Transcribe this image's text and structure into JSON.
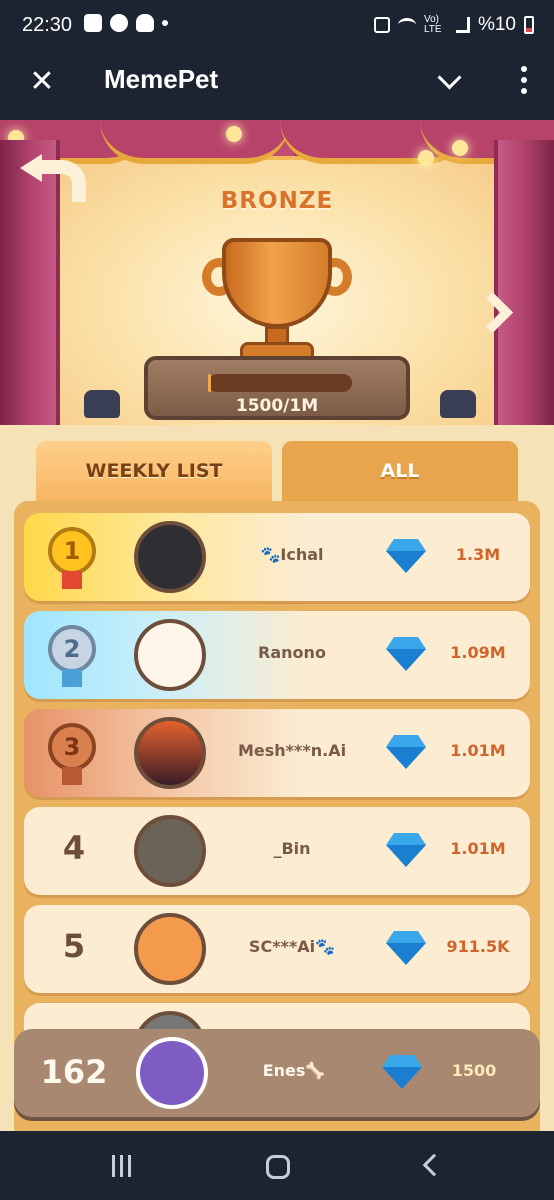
{
  "status_bar": {
    "time": "22:30",
    "battery": "%10",
    "network": "Vo) LTE"
  },
  "app_bar": {
    "title": "MemePet"
  },
  "league": {
    "name": "BRONZE",
    "progress_text": "1500/1M",
    "progress_fraction": 0.0015
  },
  "tabs": [
    {
      "label": "WEEKLY LIST",
      "active": true
    },
    {
      "label": "ALL",
      "active": false
    }
  ],
  "leaderboard": [
    {
      "rank": "1",
      "name": "🐾Ichal",
      "score": "1.3M"
    },
    {
      "rank": "2",
      "name": "Ranono",
      "score": "1.09M"
    },
    {
      "rank": "3",
      "name": "Mesh***n.Ai",
      "score": "1.01M"
    },
    {
      "rank": "4",
      "name": "_Bin",
      "score": "1.01M"
    },
    {
      "rank": "5",
      "name": "SC***Ai🐾",
      "score": "911.5K"
    }
  ],
  "current_user": {
    "rank": "162",
    "name": "Enes🦴",
    "score": "1500"
  },
  "icons": {
    "close": "close-icon",
    "chevron": "chevron-down-icon",
    "more": "more-vert-icon",
    "gem": "diamond-icon",
    "back": "back-arrow-icon",
    "next": "next-arrow-icon"
  },
  "colors": {
    "gold": "#ffd84a",
    "silver": "#9fe6ff",
    "bronze": "#e79266",
    "score": "#d0652b"
  }
}
